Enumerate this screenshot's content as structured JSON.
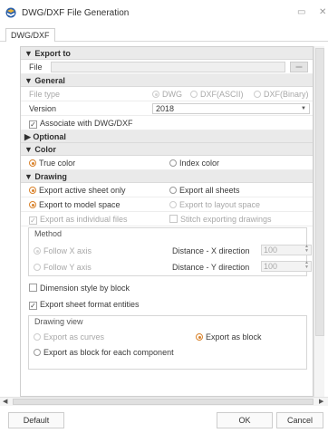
{
  "window": {
    "title": "DWG/DXF File Generation"
  },
  "tab": {
    "label": "DWG/DXF"
  },
  "export_to": {
    "header": "▼ Export to",
    "file_label": "File",
    "file_value": "",
    "browse_icon": "folder-icon"
  },
  "general": {
    "header": "▼ General",
    "file_type_label": "File type",
    "file_type_options": [
      "DWG",
      "DXF(ASCII)",
      "DXF(Binary)"
    ],
    "version_label": "Version",
    "version_value": "2018",
    "associate_label": "Associate with DWG/DXF"
  },
  "optional": {
    "header": "▶ Optional"
  },
  "color": {
    "header": "▼ Color",
    "true_color": "True color",
    "index_color": "Index color"
  },
  "drawing": {
    "header": "▼ Drawing",
    "export_active": "Export active sheet only",
    "export_all": "Export all sheets",
    "export_model": "Export to model space",
    "export_layout": "Export to layout space",
    "export_individual": "Export as individual files",
    "stitch": "Stitch exporting drawings",
    "method": {
      "title": "Method",
      "follow_x": "Follow X axis",
      "follow_y": "Follow Y axis",
      "dist_x_label": "Distance - X direction",
      "dist_x_value": "100",
      "dist_y_label": "Distance - Y direction",
      "dist_y_value": "100"
    },
    "dimension_style": "Dimension style by block",
    "sheet_format": "Export sheet format entities",
    "drawing_view": {
      "title": "Drawing view",
      "export_curves": "Export as curves",
      "export_block": "Export as block",
      "export_block_each": "Export as block for each component"
    }
  },
  "footer": {
    "default_label": "Default",
    "ok_label": "OK",
    "cancel_label": "Cancel"
  },
  "colors": {
    "accent": "#d9822b",
    "section_bg": "#eaeaea"
  }
}
